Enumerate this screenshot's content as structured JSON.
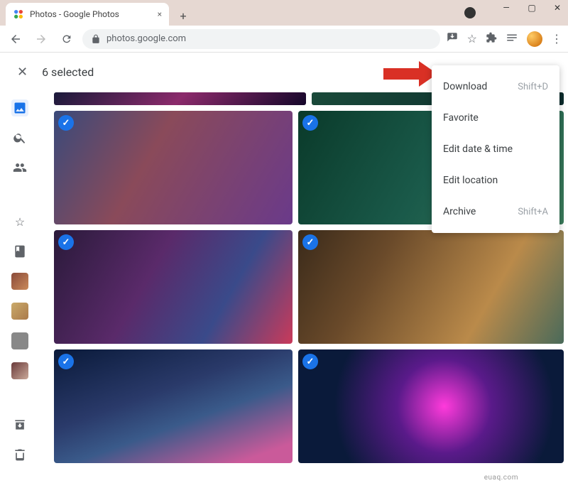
{
  "browser": {
    "tab": {
      "title": "Photos - Google Photos"
    },
    "address": "photos.google.com"
  },
  "header": {
    "selected_text": "6 selected"
  },
  "menu": {
    "items": [
      {
        "label": "Download",
        "shortcut": "Shift+D"
      },
      {
        "label": "Favorite",
        "shortcut": ""
      },
      {
        "label": "Edit date & time",
        "shortcut": ""
      },
      {
        "label": "Edit location",
        "shortcut": ""
      },
      {
        "label": "Archive",
        "shortcut": "Shift+A"
      }
    ]
  },
  "watermark": "euaq.com"
}
